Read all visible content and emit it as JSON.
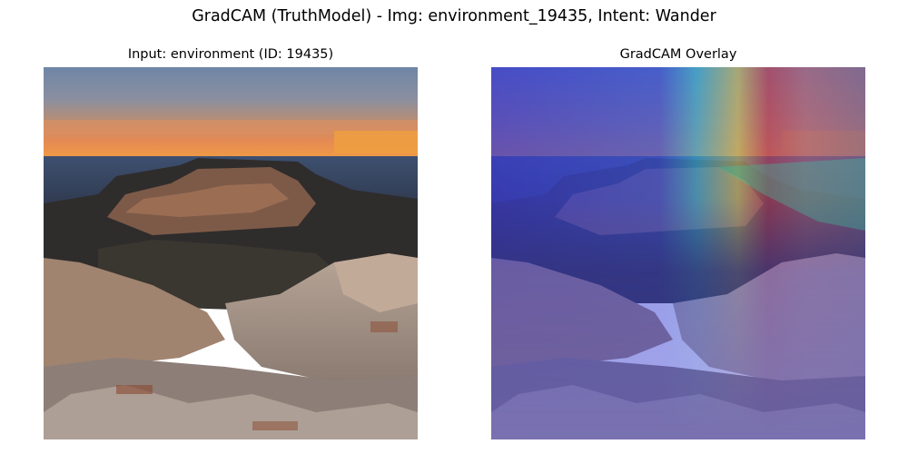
{
  "figure": {
    "title": "GradCAM (TruthModel) - Img: environment_19435, Intent: Wander"
  },
  "panels": [
    {
      "title": "Input: environment (ID: 19435)",
      "image": "canyon-landscape-photo"
    },
    {
      "title": "GradCAM Overlay",
      "image": "canyon-landscape-with-heatmap-overlay"
    }
  ],
  "colors": {
    "heatmap_low": "#3a3ad0",
    "heatmap_mid": "#3ad0d0",
    "heatmap_high_yellow": "#e8e040",
    "heatmap_high_red": "#e04030"
  }
}
